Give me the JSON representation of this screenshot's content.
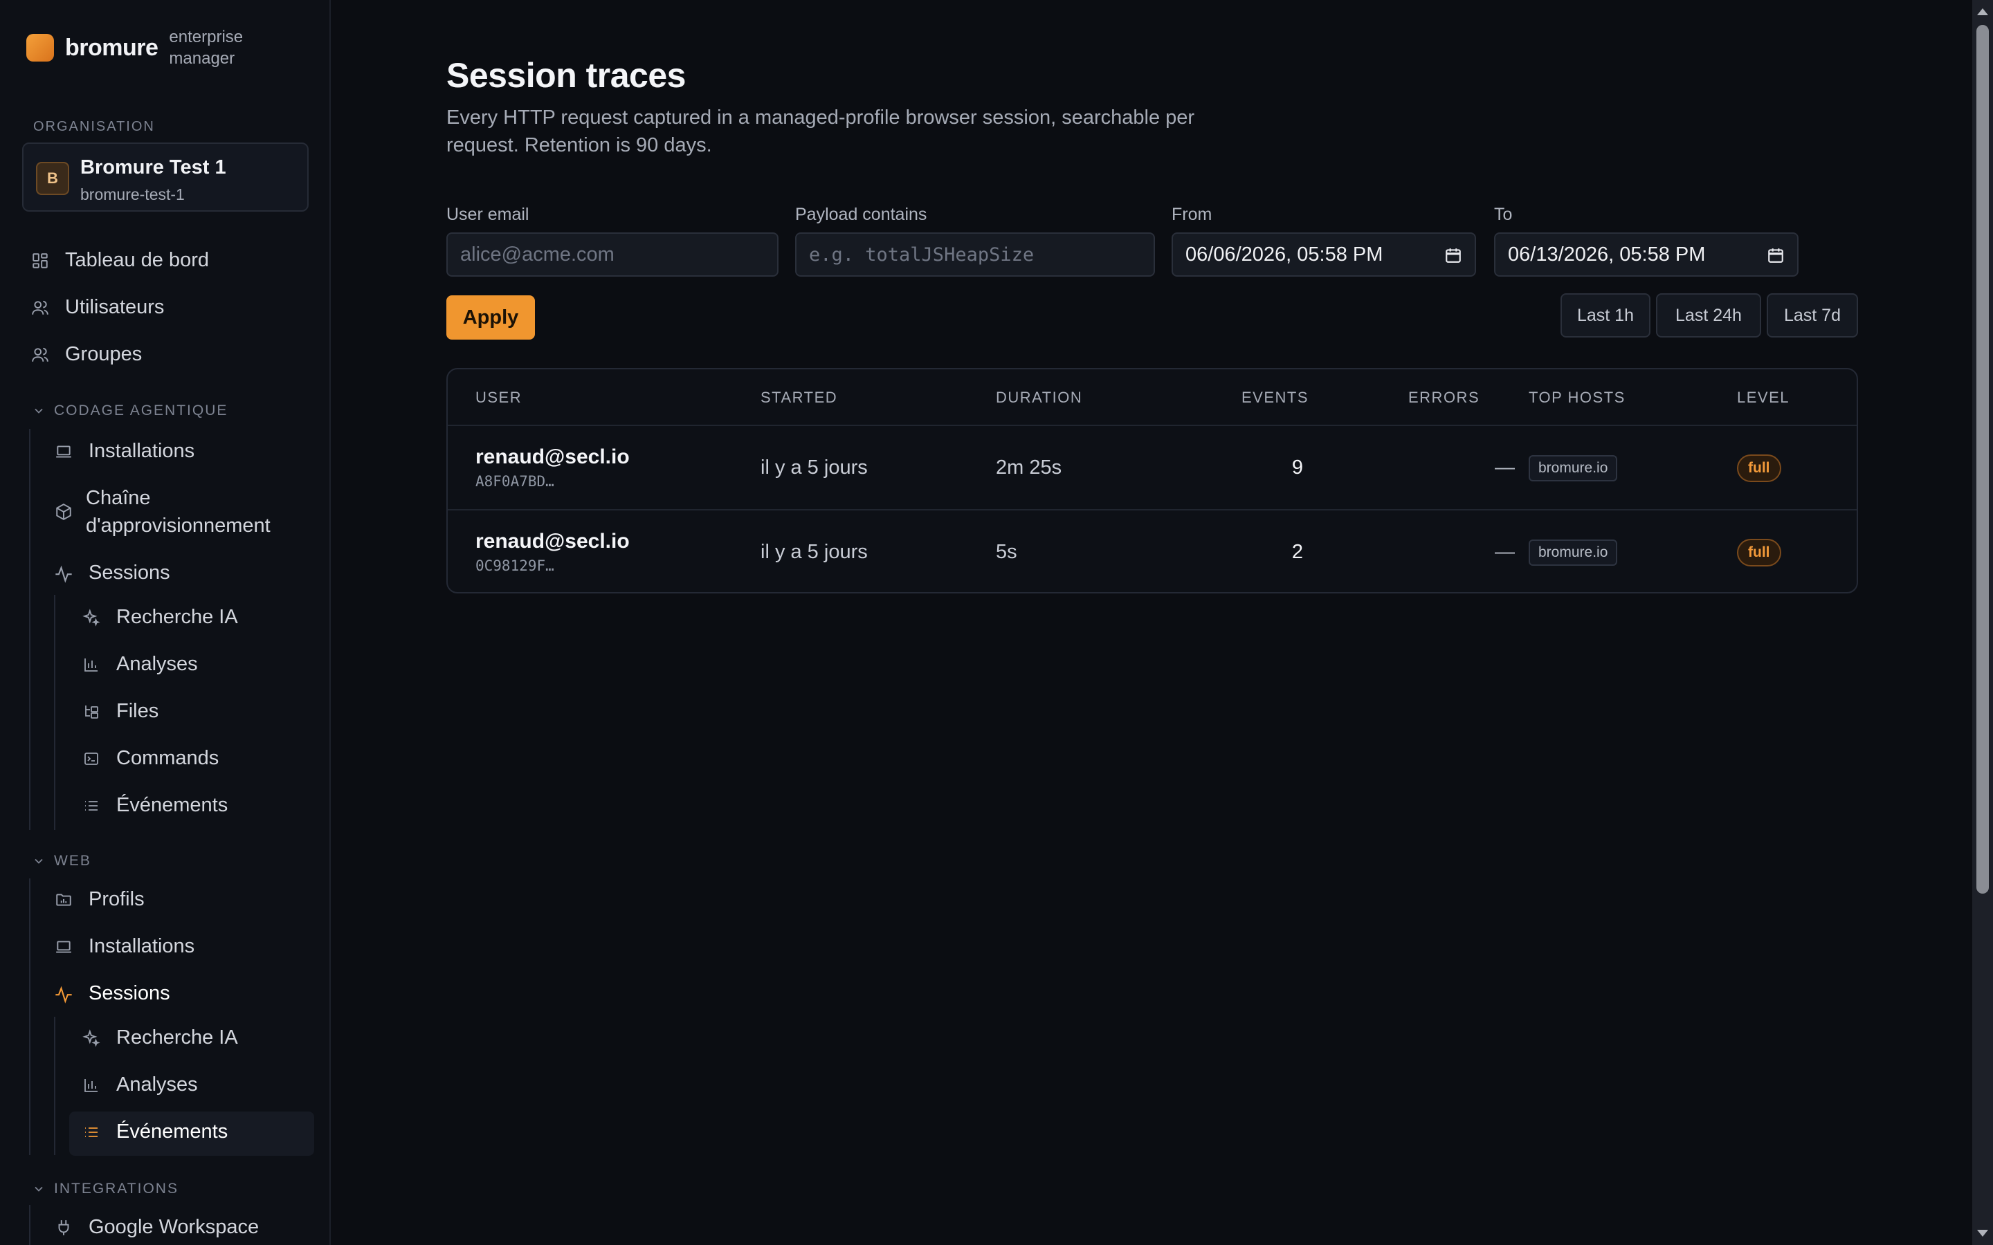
{
  "brand": {
    "name": "bromure",
    "subtitle": "enterprise manager"
  },
  "organisation": {
    "section_label": "ORGANISATION",
    "avatar_letter": "B",
    "name": "Bromure Test 1",
    "slug": "bromure-test-1"
  },
  "nav": {
    "top": [
      {
        "label": "Tableau de bord",
        "icon": "dashboard-icon"
      },
      {
        "label": "Utilisateurs",
        "icon": "users-icon"
      },
      {
        "label": "Groupes",
        "icon": "groups-icon"
      }
    ],
    "codage": {
      "heading": "CODAGE AGENTIQUE",
      "installations": "Installations",
      "supply_chain": "Chaîne d'approvisionnement",
      "sessions": "Sessions",
      "recherche_ia": "Recherche IA",
      "analyses": "Analyses",
      "files": "Files",
      "commands": "Commands",
      "evenements": "Événements"
    },
    "web": {
      "heading": "WEB",
      "profils": "Profils",
      "installations": "Installations",
      "sessions": "Sessions",
      "recherche_ia": "Recherche IA",
      "analyses": "Analyses",
      "evenements": "Événements"
    },
    "integrations": {
      "heading": "INTEGRATIONS",
      "google_workspace": "Google Workspace"
    }
  },
  "page": {
    "title": "Session traces",
    "subtitle": "Every HTTP request captured in a managed-profile browser session, searchable per request. Retention is 90 days."
  },
  "filters": {
    "user_email_label": "User email",
    "user_email_placeholder": "alice@acme.com",
    "payload_label": "Payload contains",
    "payload_placeholder": "e.g. totalJSHeapSize",
    "from_label": "From",
    "from_value": "06/06/2026, 05:58 PM",
    "to_label": "To",
    "to_value": "06/13/2026, 05:58 PM",
    "apply_label": "Apply",
    "ranges": [
      "Last 1h",
      "Last 24h",
      "Last 7d"
    ]
  },
  "table": {
    "headers": {
      "user": "USER",
      "started": "STARTED",
      "duration": "DURATION",
      "events": "EVENTS",
      "errors": "ERRORS",
      "top_hosts": "TOP HOSTS",
      "level": "LEVEL"
    },
    "rows": [
      {
        "user": "renaud@secl.io",
        "session_id": "A8F0A7BD…",
        "started": "il y a 5 jours",
        "duration": "2m 25s",
        "events": "9",
        "errors": "—",
        "top_host": "bromure.io",
        "level": "full"
      },
      {
        "user": "renaud@secl.io",
        "session_id": "0C98129F…",
        "started": "il y a 5 jours",
        "duration": "5s",
        "events": "2",
        "errors": "—",
        "top_host": "bromure.io",
        "level": "full"
      }
    ]
  },
  "colors": {
    "accent": "#f0962f",
    "background": "#0b0d12",
    "sidebar": "#0d1016"
  }
}
